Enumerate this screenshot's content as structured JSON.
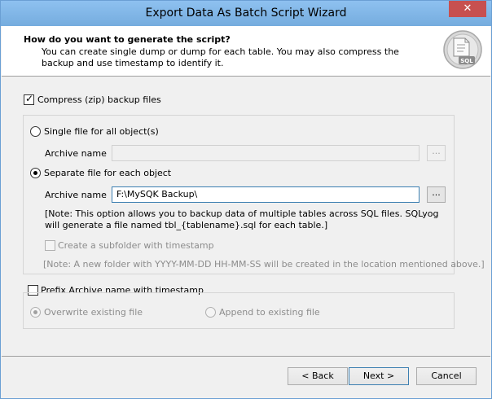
{
  "window": {
    "title": "Export Data As Batch Script Wizard",
    "close_glyph": "✕"
  },
  "header": {
    "title": "How do you want to generate the script?",
    "description": "You can create single dump or dump for each table. You may also compress the backup and use timestamp to identify it.",
    "icon": "sql-script-icon",
    "icon_text": "SQL"
  },
  "compress": {
    "label": "Compress (zip) backup files",
    "checked": true
  },
  "single_file": {
    "label": "Single file for all object(s)",
    "selected": false,
    "archive_label": "Archive name",
    "archive_value": "",
    "browse_label": "..."
  },
  "separate_file": {
    "label": "Separate file for each object",
    "selected": true,
    "archive_label": "Archive name",
    "archive_value": "F:\\MySQK Backup\\",
    "browse_label": "...",
    "note": "[Note: This option allows you to backup data of multiple tables across SQL files. SQLyog will generate a file named tbl_{tablename}.sql for each table.]",
    "subfolder_label": "Create a subfolder with timestamp",
    "subfolder_checked": false,
    "subfolder_note": "[Note: A new folder with YYYY-MM-DD HH-MM-SS will be created in the location mentioned above.]"
  },
  "prefix": {
    "label": "Prefix Archive name with timestamp",
    "checked": false,
    "overwrite_label": "Overwrite existing file",
    "append_label": "Append to existing file",
    "overwrite_selected": true
  },
  "footer": {
    "back_label": "< Back",
    "next_label": "Next >",
    "cancel_label": "Cancel"
  }
}
